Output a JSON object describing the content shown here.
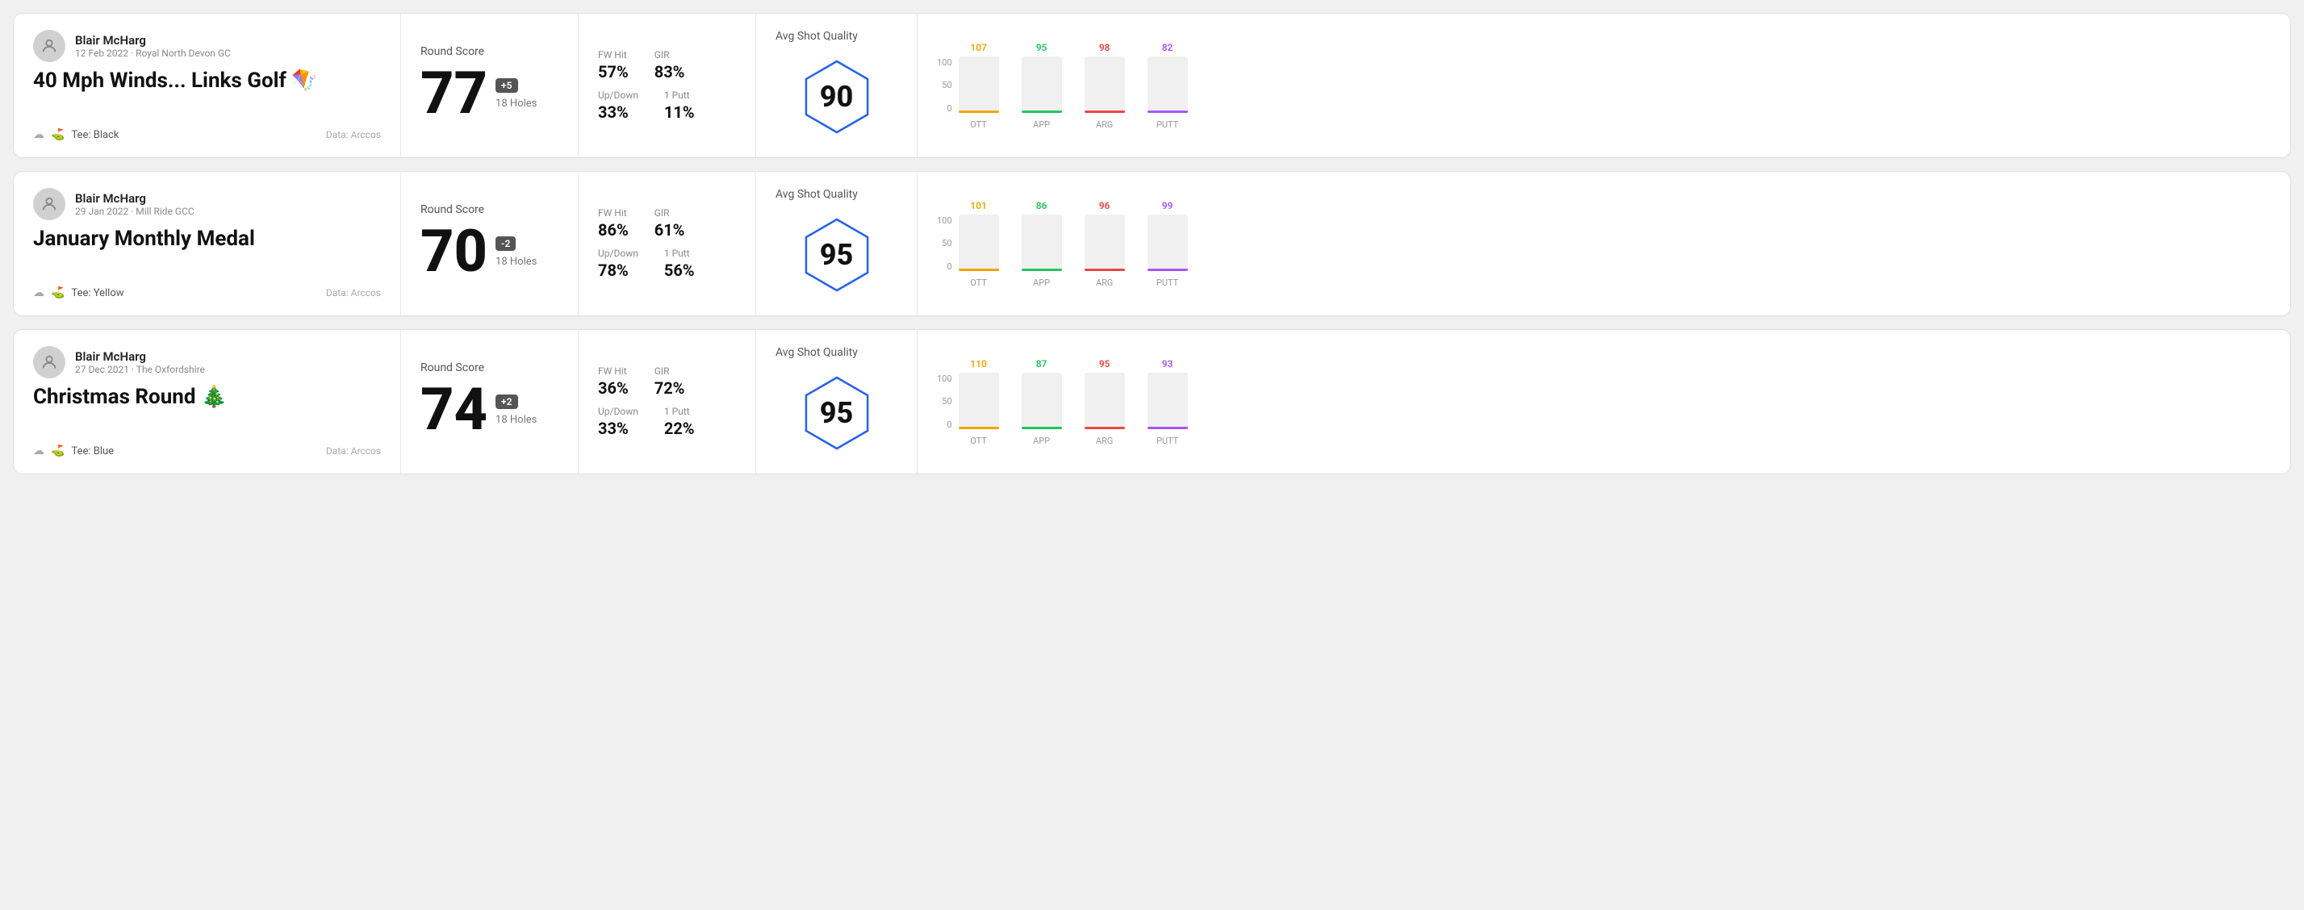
{
  "rounds": [
    {
      "id": "round1",
      "user": {
        "name": "Blair McHarg",
        "meta": "12 Feb 2022 · Royal North Devon GC",
        "tee": "Black",
        "data_source": "Data: Arccos"
      },
      "title": "40 Mph Winds... Links Golf 🪁",
      "score": "77",
      "badge": "+5",
      "holes": "18 Holes",
      "stats": {
        "fw_hit_label": "FW Hit",
        "fw_hit_value": "57%",
        "gir_label": "GIR",
        "gir_value": "83%",
        "updown_label": "Up/Down",
        "updown_value": "33%",
        "oneputt_label": "1 Putt",
        "oneputt_value": "11%"
      },
      "quality": {
        "label": "Avg Shot Quality",
        "score": "90"
      },
      "chart": {
        "bars": [
          {
            "label": "OTT",
            "value": "107",
            "color_class": "color-ott",
            "line_class": "line-ott",
            "height_pct": 70
          },
          {
            "label": "APP",
            "value": "95",
            "color_class": "color-app",
            "line_class": "line-app",
            "height_pct": 62
          },
          {
            "label": "ARG",
            "value": "98",
            "color_class": "color-arg",
            "line_class": "line-arg",
            "height_pct": 65
          },
          {
            "label": "PUTT",
            "value": "82",
            "color_class": "color-putt",
            "line_class": "line-putt",
            "height_pct": 53
          }
        ]
      }
    },
    {
      "id": "round2",
      "user": {
        "name": "Blair McHarg",
        "meta": "29 Jan 2022 · Mill Ride GCC",
        "tee": "Yellow",
        "data_source": "Data: Arccos"
      },
      "title": "January Monthly Medal",
      "score": "70",
      "badge": "-2",
      "holes": "18 Holes",
      "stats": {
        "fw_hit_label": "FW Hit",
        "fw_hit_value": "86%",
        "gir_label": "GIR",
        "gir_value": "61%",
        "updown_label": "Up/Down",
        "updown_value": "78%",
        "oneputt_label": "1 Putt",
        "oneputt_value": "56%"
      },
      "quality": {
        "label": "Avg Shot Quality",
        "score": "95"
      },
      "chart": {
        "bars": [
          {
            "label": "OTT",
            "value": "101",
            "color_class": "color-ott",
            "line_class": "line-ott",
            "height_pct": 67
          },
          {
            "label": "APP",
            "value": "86",
            "color_class": "color-app",
            "line_class": "line-app",
            "height_pct": 55
          },
          {
            "label": "ARG",
            "value": "96",
            "color_class": "color-arg",
            "line_class": "line-arg",
            "height_pct": 64
          },
          {
            "label": "PUTT",
            "value": "99",
            "color_class": "color-putt",
            "line_class": "line-putt",
            "height_pct": 66
          }
        ]
      }
    },
    {
      "id": "round3",
      "user": {
        "name": "Blair McHarg",
        "meta": "27 Dec 2021 · The Oxfordshire",
        "tee": "Blue",
        "data_source": "Data: Arccos"
      },
      "title": "Christmas Round 🎄",
      "score": "74",
      "badge": "+2",
      "holes": "18 Holes",
      "stats": {
        "fw_hit_label": "FW Hit",
        "fw_hit_value": "36%",
        "gir_label": "GIR",
        "gir_value": "72%",
        "updown_label": "Up/Down",
        "updown_value": "33%",
        "oneputt_label": "1 Putt",
        "oneputt_value": "22%"
      },
      "quality": {
        "label": "Avg Shot Quality",
        "score": "95"
      },
      "chart": {
        "bars": [
          {
            "label": "OTT",
            "value": "110",
            "color_class": "color-ott",
            "line_class": "line-ott",
            "height_pct": 73
          },
          {
            "label": "APP",
            "value": "87",
            "color_class": "color-app",
            "line_class": "line-app",
            "height_pct": 57
          },
          {
            "label": "ARG",
            "value": "95",
            "color_class": "color-arg",
            "line_class": "line-arg",
            "height_pct": 63
          },
          {
            "label": "PUTT",
            "value": "93",
            "color_class": "color-putt",
            "line_class": "line-putt",
            "height_pct": 62
          }
        ]
      }
    }
  ],
  "y_axis": {
    "labels": [
      "100",
      "50",
      "0"
    ]
  }
}
